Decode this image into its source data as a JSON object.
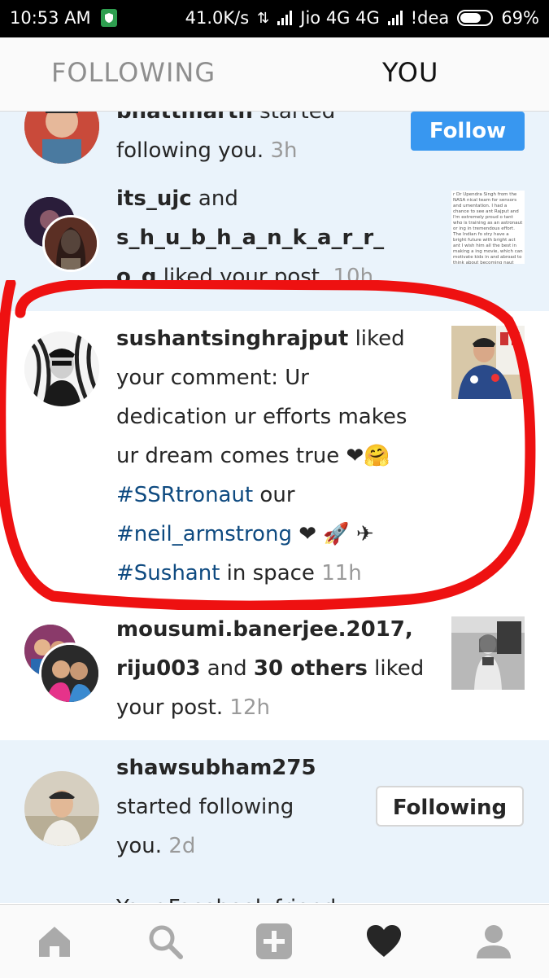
{
  "status_bar": {
    "time": "10:53 AM",
    "network_speed": "41.0K/s",
    "carrier1": "Jio 4G 4G",
    "carrier2": "!dea",
    "battery": "69%",
    "battery_level": 0.69
  },
  "tabs": {
    "following": "FOLLOWING",
    "you": "YOU"
  },
  "activity": [
    {
      "user": "bhattmarth",
      "action": " started",
      "action2": "following you.",
      "time": "3h",
      "button": "Follow"
    },
    {
      "user1": "its_ujc",
      "joiner": " and",
      "user2": "s_h_u_b_h_a_n_k_a_r_r_",
      "user2_cont": "o_g",
      "action": " liked your post.",
      "time": "10h"
    },
    {
      "user": "sushantsinghrajput",
      "action": " liked",
      "line2": "your comment: Ur",
      "line3": "dedication ur efforts makes",
      "line4": "ur dream comes true ❤🤗",
      "tag1": "#SSRtronaut",
      "line5_rest": "  our",
      "tag2": "#neil_armstrong",
      "line6_rest": " ❤ 🚀 ✈",
      "tag3": "#Sushant",
      "line7_rest": " in space",
      "time": "11h"
    },
    {
      "user1": "mousumi.banerjee.2017,",
      "user2": "riju003",
      "joiner": " and ",
      "others": "30 others",
      "action": " liked",
      "action2": "your post.",
      "time": "12h"
    },
    {
      "user": "shawsubham275",
      "action": "started following",
      "action2": "you.",
      "time": "2d",
      "button": "Following"
    },
    {
      "text": "Your Facebook friend"
    }
  ],
  "thumb_text": "r Dr Upendra Singh from the NASA nical team for sensors and umentation. I had a chance to see ant Rajput and I'm extremely proud o tant who is training as an astronaut or ing in tremendous effort. The Indian fo stry have a bright future with bright act ant I wish him all the best in making a ing movie, which can motivate kids in and abroad to think about becoming naut one day to explore a distant pla",
  "nav": [
    "home-icon",
    "search-icon",
    "add-icon",
    "heart-icon",
    "profile-icon"
  ],
  "colors": {
    "accent": "#3897f0",
    "hashtag": "#0e4a80",
    "annotation": "#ee1111",
    "unread_bg": "#eaf3fb"
  }
}
